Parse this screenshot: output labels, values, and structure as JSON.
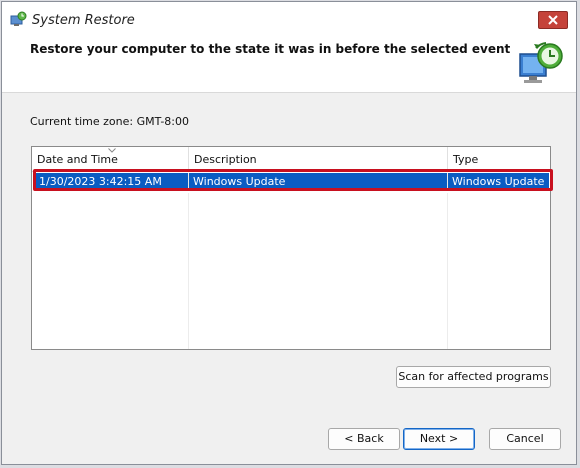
{
  "window": {
    "title": "System Restore",
    "heading": "Restore your computer to the state it was in before the selected event"
  },
  "timezone": "Current time zone: GMT-8:00",
  "table": {
    "columns": [
      "Date and Time",
      "Description",
      "Type"
    ],
    "rows": [
      [
        "1/30/2023 3:42:15 AM",
        "Windows Update",
        "Windows Update"
      ]
    ]
  },
  "buttons": {
    "scan": "Scan for affected programs",
    "back": "< Back",
    "next": "Next >",
    "cancel": "Cancel"
  },
  "colors": {
    "selection": "#0a5cc2",
    "highlight_border": "#c8101f",
    "close_button": "#c5433a"
  }
}
